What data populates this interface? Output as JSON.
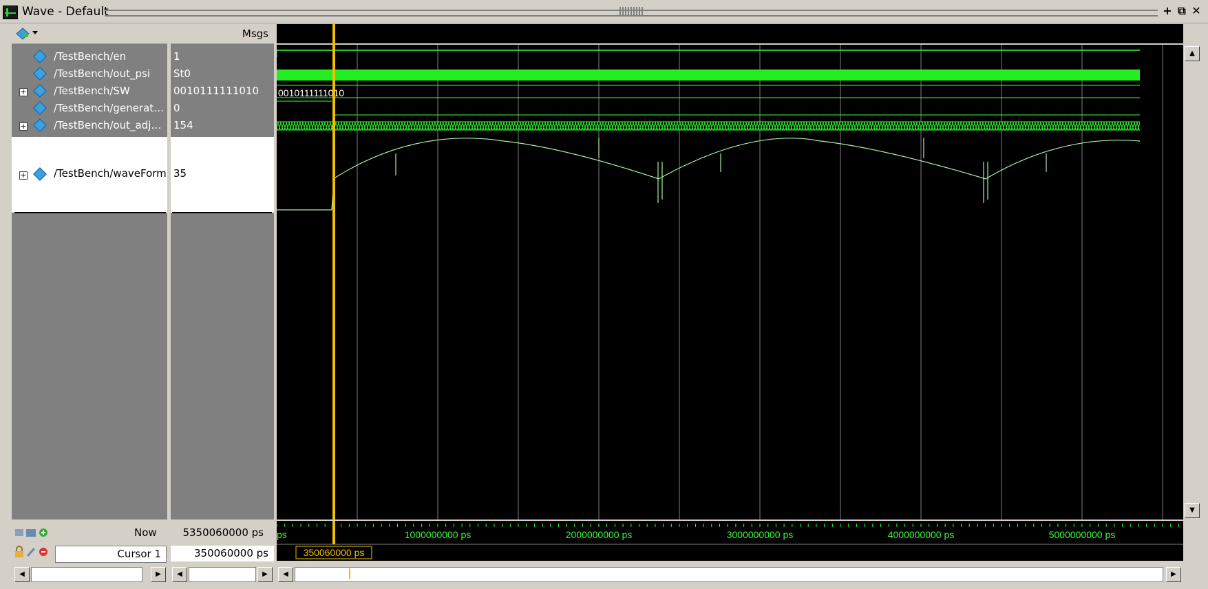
{
  "window": {
    "title": "Wave - Default",
    "controls": [
      "+",
      "⧉",
      "✕"
    ]
  },
  "header": {
    "msgs_label": "Msgs"
  },
  "signals": [
    {
      "name": "/TestBench/en",
      "value": "1",
      "expandable": false
    },
    {
      "name": "/TestBench/out_psi",
      "value": "St0",
      "expandable": false
    },
    {
      "name": "/TestBench/SW",
      "value": "0010111111010",
      "expandable": true
    },
    {
      "name": "/TestBench/generat…",
      "value": "0",
      "expandable": false
    },
    {
      "name": "/TestBench/out_adj…",
      "value": "154",
      "expandable": true
    },
    {
      "name": "/TestBench/waveForm",
      "value": "35",
      "expandable": true
    }
  ],
  "wave": {
    "sw_bus_label": "0010111111010",
    "time_labels": [
      "ps",
      "1000000000 ps",
      "2000000000 ps",
      "3000000000 ps",
      "4000000000 ps",
      "5000000000 ps"
    ],
    "cursor_time": "350060000 ps",
    "colors": {
      "signal": "#33ff33",
      "analog": "#a8f0a8",
      "cursor": "#f0c000",
      "grid": "#808080"
    }
  },
  "footer": {
    "now_label": "Now",
    "now_value": "5350060000 ps",
    "cursor_label": "Cursor 1",
    "cursor_value": "350060000 ps"
  }
}
